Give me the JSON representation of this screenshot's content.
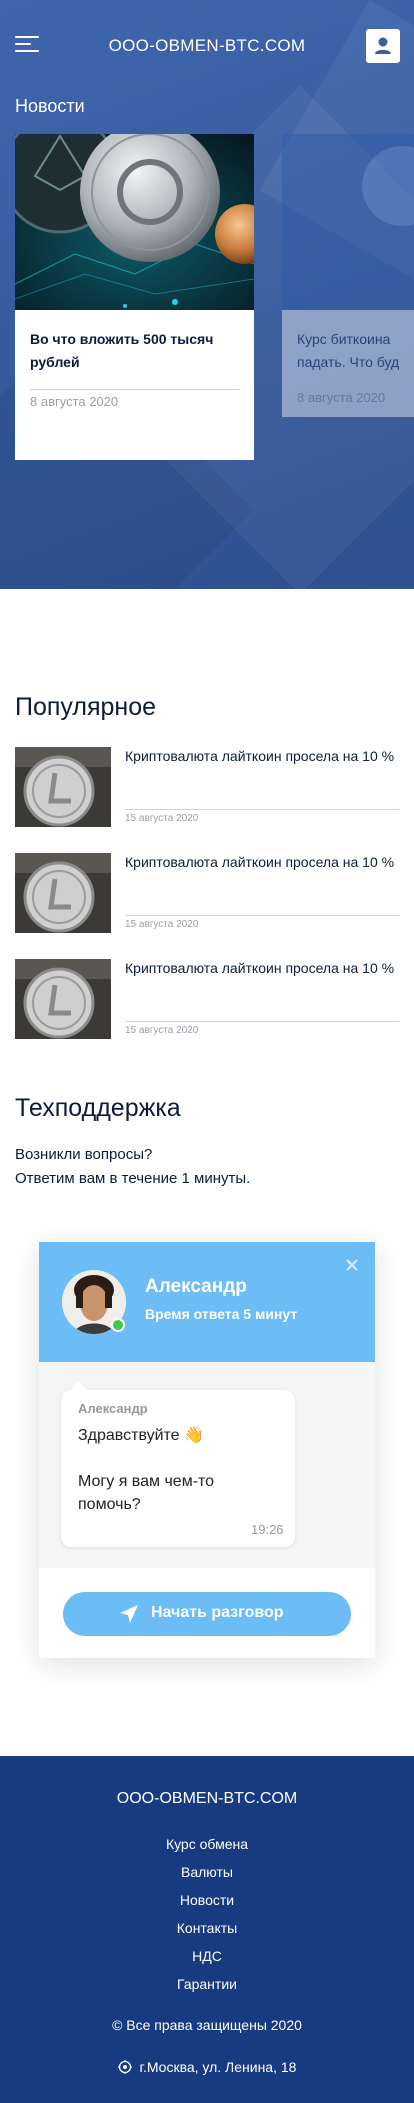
{
  "header": {
    "brand": "OOO-OBMEN-BTC.COM",
    "menu_icon": "hamburger-menu-icon",
    "profile_icon": "user-icon"
  },
  "news": {
    "heading": "Новости",
    "cards": [
      {
        "title": "Во что вложить 500 тысяч рублей",
        "date": "8 августа 2020",
        "image": "crypto-coins-image"
      },
      {
        "title": "Курс биткоина падать. Что буд",
        "date": "8 августа 2020",
        "image": "bitcoin-image"
      }
    ]
  },
  "popular": {
    "heading": "Популярное",
    "items": [
      {
        "title": "Криптовалюта лайткоин просела на 10 %",
        "date": "15 августа 2020",
        "image": "litecoin-image"
      },
      {
        "title": "Криптовалюта лайткоин просела на 10 %",
        "date": "15 августа 2020",
        "image": "litecoin-image"
      },
      {
        "title": "Криптовалюта лайткоин просела на 10 %",
        "date": "15 августа 2020",
        "image": "litecoin-image"
      }
    ]
  },
  "support": {
    "heading": "Техподдержка",
    "line1": "Возникли вопросы?",
    "line2": "Ответим вам в течение 1 минуты."
  },
  "chat": {
    "agent_name": "Александр",
    "response_time": "Время ответа 5 минут",
    "message_author": "Александр",
    "message_greeting": "Здравствуйте 👋",
    "message_question": "Могу я вам чем-то помочь?",
    "message_time": "19:26",
    "start_button": "Начать разговор",
    "colors": {
      "accent": "#6cbcf5",
      "online": "#3ccb4b"
    }
  },
  "footer": {
    "brand": "OOO-OBMEN-BTC.COM",
    "links": [
      "Курс обмена",
      "Валюты",
      "Новости",
      "Контакты",
      "НДС",
      "Гарантии"
    ],
    "copyright": "© Все права защищены 2020",
    "address": "г.Москва, ул. Ленина, 18",
    "colors": {
      "background": "#173a80"
    }
  }
}
